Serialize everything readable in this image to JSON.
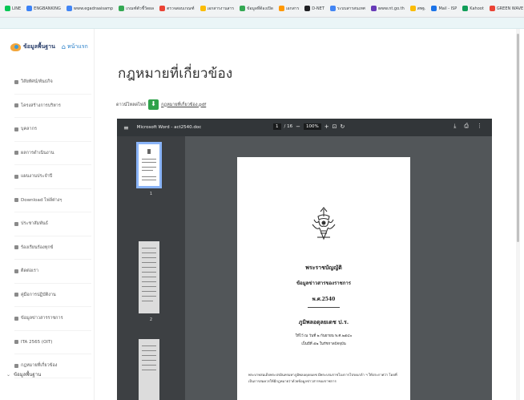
{
  "bookmarks": [
    {
      "label": "LINE",
      "color": "#06c755"
    },
    {
      "label": "ENGBANKING",
      "color": "#3b82f6"
    },
    {
      "label": "www.egadraaisamp",
      "color": "#4285f4"
    },
    {
      "label": "เกณฑ์ตัวชี้วัดผล",
      "color": "#34a853"
    },
    {
      "label": "ตรวจสอบเกณฑ์",
      "color": "#ea4335"
    },
    {
      "label": "เอกสารงานสาร",
      "color": "#fbbc05"
    },
    {
      "label": "ข้อมูลที่ต้องเปิด",
      "color": "#34a853"
    },
    {
      "label": "เอกสาร",
      "color": "#ff9800"
    },
    {
      "label": "D-NET",
      "color": "#202124"
    },
    {
      "label": "ระบบสารสนเทศ",
      "color": "#4285f4"
    },
    {
      "label": "www.nt.go.th",
      "color": "#673ab7"
    },
    {
      "label": "สพฐ.",
      "color": "#fbbc05"
    },
    {
      "label": "Mail - ISP",
      "color": "#1a73e8"
    },
    {
      "label": "Kahoot",
      "color": "#0f9d58"
    },
    {
      "label": "GREEN WAVE",
      "color": "#ea4335"
    },
    {
      "label": "MOC Market",
      "color": "#ff9800"
    }
  ],
  "sidebar": {
    "brand": "ข้อมูลพื้นฐาน",
    "home": "หน้าแรก",
    "items": [
      "วิสัยทัศน์/พันธกิจ",
      "โครงสร้างการบริหาร",
      "บุคลากร",
      "ผลการดำเนินงาน",
      "แผนงานประจำปี",
      "Download ไฟล์ต่างๆ",
      "ประชาสัมพันธ์",
      "ร้องเรียนร้องทุกข์",
      "ติดต่อเรา",
      "คู่มือการปฏิบัติงาน",
      "ข้อมูลข่าวสารราชการ",
      "ITA 2565 (OIT)",
      "กฎหมายที่เกี่ยวข้อง"
    ],
    "last_item": "ข้อมูลพื้นฐาน"
  },
  "main": {
    "title": "กฎหมายที่เกี่ยวข้อง",
    "download_prefix": "ดาวน์โหลดไฟล์",
    "download_suffix": "กฎหมายที่เกี่ยวข้อง.pdf"
  },
  "viewer": {
    "filename": "Microsoft Word - act2540.doc",
    "page_current": "1",
    "page_total": "/ 16",
    "zoom": "100%",
    "thumb_numbers": [
      "1",
      "2"
    ],
    "document": {
      "heading1": "พระราชบัญญัติ",
      "heading2": "ข้อมูลข่าวสารของราชการ",
      "heading3": "พ.ศ.2540",
      "heading4": "ภูมิพลอดุลยเดช ป.ร.",
      "line5": "ให้ไว้ ณ วันที่ ๒ กันยายน พ.ศ.๒๕๔๐",
      "line6": "เป็นปีที่ ๕๒ ในรัชกาลปัจจุบัน",
      "paragraph": "พระบาทสมเด็จพระปรมินทรมหาภูมิพลอดุลยเดช มีพระบรมราชโองการโปรดเกล้า ฯ ให้ประกาศว่า โดยที่เป็นการสมควรให้มีกฎหมายว่าด้วยข้อมูลข่าวสารของราชการ"
    }
  }
}
